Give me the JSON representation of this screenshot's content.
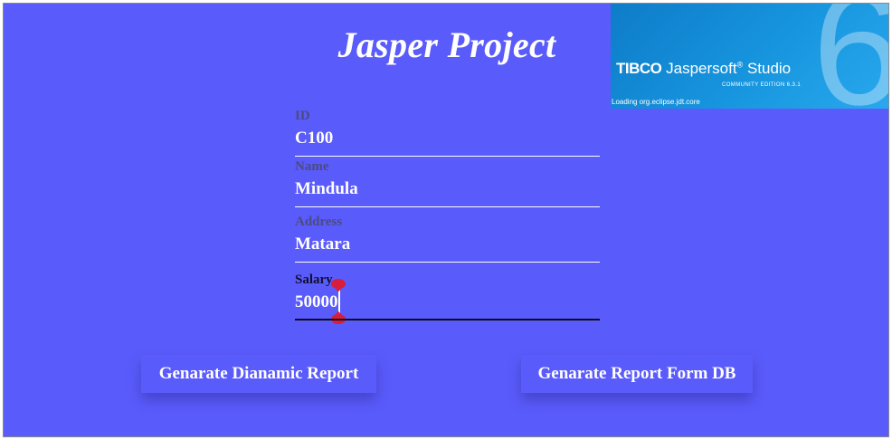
{
  "app": {
    "title": "Jasper Project"
  },
  "splash": {
    "brand_tibco": "TIBCO",
    "brand_product": "Jaspersoft",
    "brand_reg": "®",
    "brand_studio": "Studio",
    "edition": "COMMUNITY EDITION 6.3.1",
    "version_glyph": "6",
    "loading_text": "Loading org.eclipse.jdt.core"
  },
  "form": {
    "id": {
      "label": "ID",
      "value": "C100"
    },
    "name": {
      "label": "Name",
      "value": "Mindula"
    },
    "address": {
      "label": "Address",
      "value": "Matara"
    },
    "salary": {
      "label": "Salary",
      "value": "50000"
    }
  },
  "buttons": {
    "dynamic_report": "Genarate Dianamic Report",
    "db_report": "Genarate Report Form DB"
  },
  "colors": {
    "background": "#5a5bfb",
    "accent_handle": "#d81e3c",
    "splash_blue": "#1795de"
  }
}
